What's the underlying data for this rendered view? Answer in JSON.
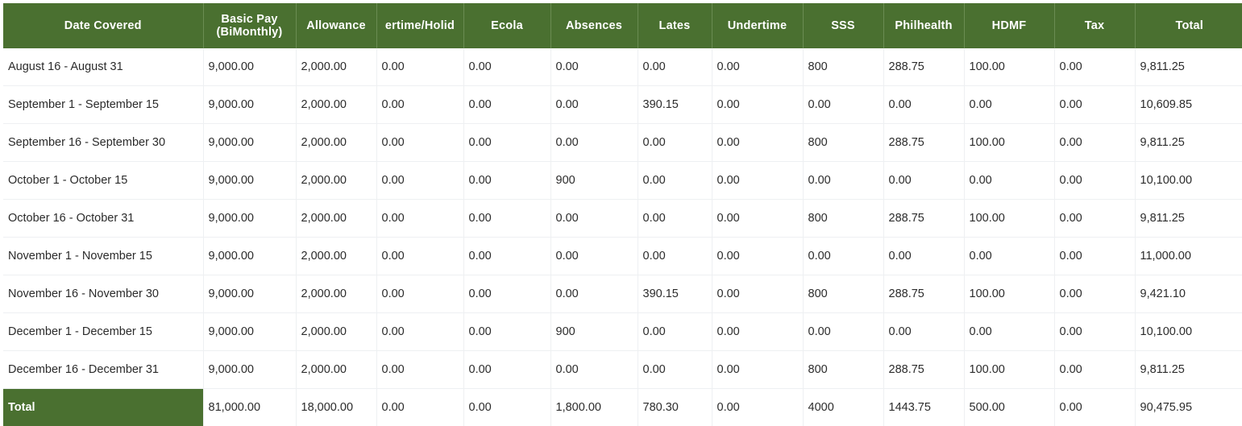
{
  "table": {
    "columns": [
      {
        "key": "date",
        "label": "Date Covered",
        "clipped": false
      },
      {
        "key": "basic",
        "label": "Basic Pay\n(BiMonthly)",
        "clipped": false
      },
      {
        "key": "allow",
        "label": "Allowance",
        "clipped": false
      },
      {
        "key": "ot",
        "label": "Overtime/Holiday",
        "clipped": true
      },
      {
        "key": "ecola",
        "label": "Ecola",
        "clipped": false
      },
      {
        "key": "abs",
        "label": "Absences",
        "clipped": false
      },
      {
        "key": "lates",
        "label": "Lates",
        "clipped": false
      },
      {
        "key": "under",
        "label": "Undertime",
        "clipped": false
      },
      {
        "key": "sss",
        "label": "SSS",
        "clipped": false
      },
      {
        "key": "phil",
        "label": "Philhealth",
        "clipped": false
      },
      {
        "key": "hdmf",
        "label": "HDMF",
        "clipped": false
      },
      {
        "key": "tax",
        "label": "Tax",
        "clipped": false
      },
      {
        "key": "total",
        "label": "Total",
        "clipped": false
      }
    ],
    "header_basic_pay_line1": "Basic Pay",
    "header_basic_pay_line2": "(BiMonthly)",
    "header_overtime_visible": "ertime/Holid",
    "rows": [
      {
        "date": "August 16 - August 31",
        "basic": "9,000.00",
        "allow": "2,000.00",
        "ot": "0.00",
        "ecola": "0.00",
        "abs": "0.00",
        "lates": "0.00",
        "under": "0.00",
        "sss": "800",
        "phil": "288.75",
        "hdmf": "100.00",
        "tax": "0.00",
        "total": "9,811.25"
      },
      {
        "date": "September 1 - September 15",
        "basic": "9,000.00",
        "allow": "2,000.00",
        "ot": "0.00",
        "ecola": "0.00",
        "abs": "0.00",
        "lates": "390.15",
        "under": "0.00",
        "sss": "0.00",
        "phil": "0.00",
        "hdmf": "0.00",
        "tax": "0.00",
        "total": "10,609.85"
      },
      {
        "date": "September 16 - September 30",
        "basic": "9,000.00",
        "allow": "2,000.00",
        "ot": "0.00",
        "ecola": "0.00",
        "abs": "0.00",
        "lates": "0.00",
        "under": "0.00",
        "sss": "800",
        "phil": "288.75",
        "hdmf": "100.00",
        "tax": "0.00",
        "total": "9,811.25"
      },
      {
        "date": "October 1 - October 15",
        "basic": "9,000.00",
        "allow": "2,000.00",
        "ot": "0.00",
        "ecola": "0.00",
        "abs": "900",
        "lates": "0.00",
        "under": "0.00",
        "sss": "0.00",
        "phil": "0.00",
        "hdmf": "0.00",
        "tax": "0.00",
        "total": "10,100.00"
      },
      {
        "date": "October 16 - October 31",
        "basic": "9,000.00",
        "allow": "2,000.00",
        "ot": "0.00",
        "ecola": "0.00",
        "abs": "0.00",
        "lates": "0.00",
        "under": "0.00",
        "sss": "800",
        "phil": "288.75",
        "hdmf": "100.00",
        "tax": "0.00",
        "total": "9,811.25"
      },
      {
        "date": "November 1 - November 15",
        "basic": "9,000.00",
        "allow": "2,000.00",
        "ot": "0.00",
        "ecola": "0.00",
        "abs": "0.00",
        "lates": "0.00",
        "under": "0.00",
        "sss": "0.00",
        "phil": "0.00",
        "hdmf": "0.00",
        "tax": "0.00",
        "total": "11,000.00"
      },
      {
        "date": "November 16 - November 30",
        "basic": "9,000.00",
        "allow": "2,000.00",
        "ot": "0.00",
        "ecola": "0.00",
        "abs": "0.00",
        "lates": "390.15",
        "under": "0.00",
        "sss": "800",
        "phil": "288.75",
        "hdmf": "100.00",
        "tax": "0.00",
        "total": "9,421.10"
      },
      {
        "date": "December 1 - December 15",
        "basic": "9,000.00",
        "allow": "2,000.00",
        "ot": "0.00",
        "ecola": "0.00",
        "abs": "900",
        "lates": "0.00",
        "under": "0.00",
        "sss": "0.00",
        "phil": "0.00",
        "hdmf": "0.00",
        "tax": "0.00",
        "total": "10,100.00"
      },
      {
        "date": "December 16 - December 31",
        "basic": "9,000.00",
        "allow": "2,000.00",
        "ot": "0.00",
        "ecola": "0.00",
        "abs": "0.00",
        "lates": "0.00",
        "under": "0.00",
        "sss": "800",
        "phil": "288.75",
        "hdmf": "100.00",
        "tax": "0.00",
        "total": "9,811.25"
      }
    ],
    "total_row": {
      "date": "Total",
      "basic": "81,000.00",
      "allow": "18,000.00",
      "ot": "0.00",
      "ecola": "0.00",
      "abs": "1,800.00",
      "lates": "780.30",
      "under": "0.00",
      "sss": "4000",
      "phil": "1443.75",
      "hdmf": "500.00",
      "tax": "0.00",
      "total": "90,475.95"
    }
  },
  "colors": {
    "header_green": "#4a7030",
    "header_text": "#ffffff",
    "row_divider": "#eef0f2",
    "body_text": "#2b2b2b",
    "page_background": "#ffffff"
  }
}
